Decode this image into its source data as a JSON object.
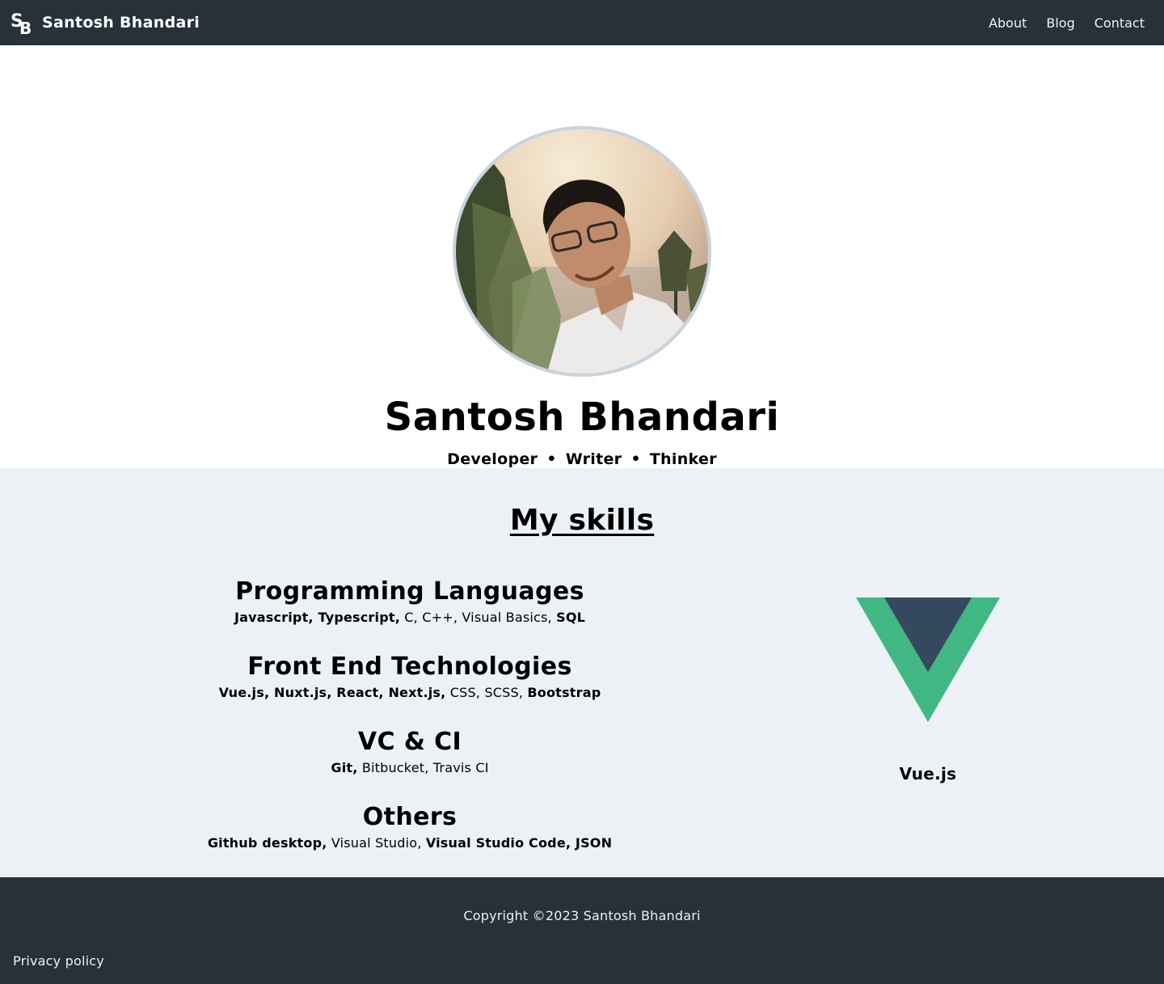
{
  "navbar": {
    "brand_name": "Santosh Bhandari",
    "brand_logo_icon": "sb-monogram-icon",
    "links": [
      "About",
      "Blog",
      "Contact"
    ],
    "background": "#263139"
  },
  "hero": {
    "name": "Santosh Bhandari",
    "tagline": [
      "Developer",
      "Writer",
      "Thinker"
    ],
    "tagline_separator": "•",
    "avatar": "profile-photo"
  },
  "skills": {
    "title": "My skills",
    "background": "#ebf1f5",
    "groups": [
      {
        "heading": "Programming Languages",
        "items": [
          {
            "text": "Javascript, Typescript,",
            "bold": true
          },
          {
            "text": " C, C++, Visual Basics, ",
            "bold": false
          },
          {
            "text": "SQL",
            "bold": true
          }
        ]
      },
      {
        "heading": "Front End Technologies",
        "items": [
          {
            "text": "Vue.js, Nuxt.js, React, Next.js,",
            "bold": true
          },
          {
            "text": " CSS, SCSS, ",
            "bold": false
          },
          {
            "text": "Bootstrap",
            "bold": true
          }
        ]
      },
      {
        "heading": "VC & CI",
        "items": [
          {
            "text": "Git,",
            "bold": true
          },
          {
            "text": " Bitbucket, Travis CI",
            "bold": false
          }
        ]
      },
      {
        "heading": "Others",
        "items": [
          {
            "text": "Github desktop,",
            "bold": true
          },
          {
            "text": " Visual Studio, ",
            "bold": false
          },
          {
            "text": "Visual Studio Code, JSON",
            "bold": true
          }
        ]
      }
    ],
    "showcase": {
      "label": "Vue.js",
      "icon": "vuejs-logo-icon",
      "colors": {
        "outer": "#41b883",
        "inner": "#34495e"
      }
    }
  },
  "footer": {
    "copyright": "Copyright ©2023 Santosh Bhandari",
    "privacy_link": "Privacy policy"
  }
}
